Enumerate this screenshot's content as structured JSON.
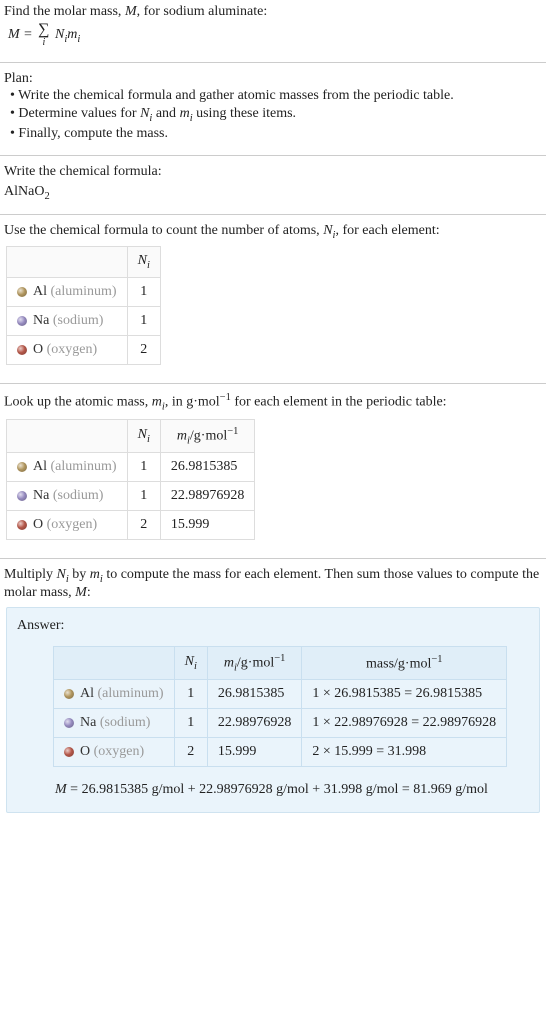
{
  "intro": {
    "line1": "Find the molar mass, ",
    "line1_var": "M",
    "line1_cont": ", for sodium aluminate:",
    "eq_left": "M",
    "eq_eq": " = ",
    "eq_sum_under": "i",
    "eq_rhs1": "N",
    "eq_rhs1_sub": "i",
    "eq_rhs2": "m",
    "eq_rhs2_sub": "i"
  },
  "plan": {
    "heading": "Plan:",
    "items": [
      "• Write the chemical formula and gather atomic masses from the periodic table.",
      "",
      "• Finally, compute the mass."
    ],
    "item2_pre": "• Determine values for ",
    "item2_N": "N",
    "item2_i": "i",
    "item2_mid": " and ",
    "item2_m": "m",
    "item2_i2": "i",
    "item2_post": " using these items."
  },
  "formula_sec": {
    "heading": "Write the chemical formula:",
    "formula_main": "AlNaO",
    "formula_sub": "2"
  },
  "count_sec": {
    "heading_pre": "Use the chemical formula to count the number of atoms, ",
    "heading_N": "N",
    "heading_i": "i",
    "heading_post": ", for each element:",
    "col_N": "N",
    "col_N_sub": "i"
  },
  "elements": [
    {
      "sym": "Al",
      "name": "(aluminum)",
      "color": "#b59a62",
      "N": "1",
      "m": "26.9815385",
      "mass_expr": "1 × 26.9815385 = 26.9815385"
    },
    {
      "sym": "Na",
      "name": "(sodium)",
      "color": "#9a8fc4",
      "N": "1",
      "m": "22.98976928",
      "mass_expr": "1 × 22.98976928 = 22.98976928"
    },
    {
      "sym": "O",
      "name": "(oxygen)",
      "color": "#b85a4c",
      "N": "2",
      "m": "15.999",
      "mass_expr": "2 × 15.999 = 31.998"
    }
  ],
  "mass_sec": {
    "heading_pre": "Look up the atomic mass, ",
    "heading_m": "m",
    "heading_i": "i",
    "heading_mid": ", in g·mol",
    "heading_exp": "−1",
    "heading_post": " for each element in the periodic table:",
    "col_m_pre": "m",
    "col_m_sub": "i",
    "col_m_unit_pre": "/g·mol",
    "col_m_unit_exp": "−1"
  },
  "mult_sec": {
    "line_pre": "Multiply ",
    "N": "N",
    "Ni": "i",
    "mid1": " by ",
    "m": "m",
    "mi": "i",
    "mid2": " to compute the mass for each element. Then sum those values to compute the molar mass, ",
    "M": "M",
    "end": ":"
  },
  "answer": {
    "label": "Answer:",
    "col_mass_pre": "mass/g·mol",
    "col_mass_exp": "−1",
    "final_pre": "M",
    "final_expr": " = 26.9815385 g/mol + 22.98976928 g/mol + 31.998 g/mol = 81.969 g/mol"
  }
}
